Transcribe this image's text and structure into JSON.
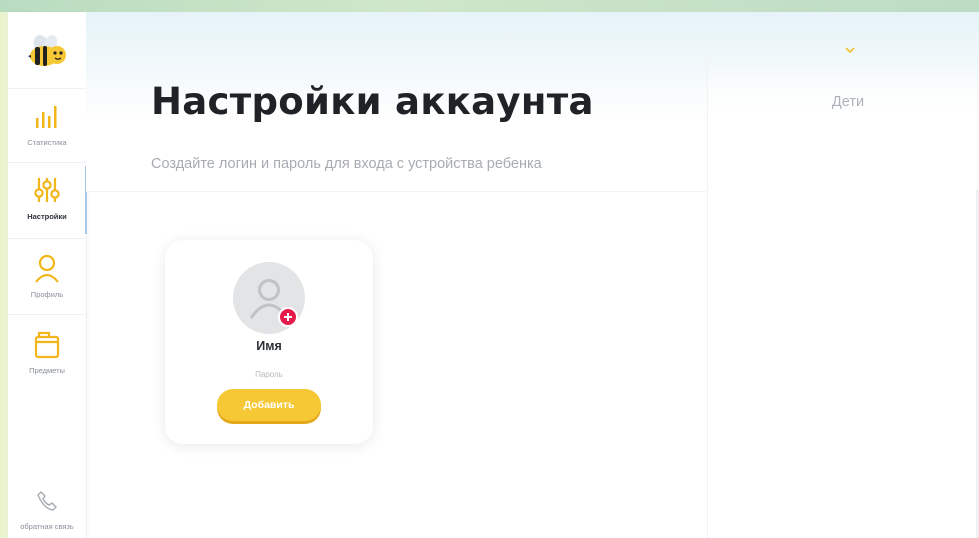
{
  "header": {
    "title": "Настройки аккаунта",
    "subtitle": "Создайте логин и пароль для входа с устройства ребенка"
  },
  "sidebar": {
    "items": [
      {
        "label": "Статистика",
        "icon": "bar-chart-icon"
      },
      {
        "label": "Настройки",
        "icon": "sliders-icon",
        "active": true
      },
      {
        "label": "Профиль",
        "icon": "person-icon"
      },
      {
        "label": "Предметы",
        "icon": "folder-icon"
      }
    ],
    "feedback_label": "обратная связь"
  },
  "kids_panel": {
    "title": "Дети"
  },
  "child_card": {
    "name_placeholder": "Имя",
    "password_placeholder": "Пароль",
    "add_button_label": "Добавить"
  },
  "colors": {
    "accent_yellow": "#f7c835",
    "badge_red": "#e5194a",
    "title_text": "#1f2226",
    "muted_text": "#a7abb2"
  }
}
